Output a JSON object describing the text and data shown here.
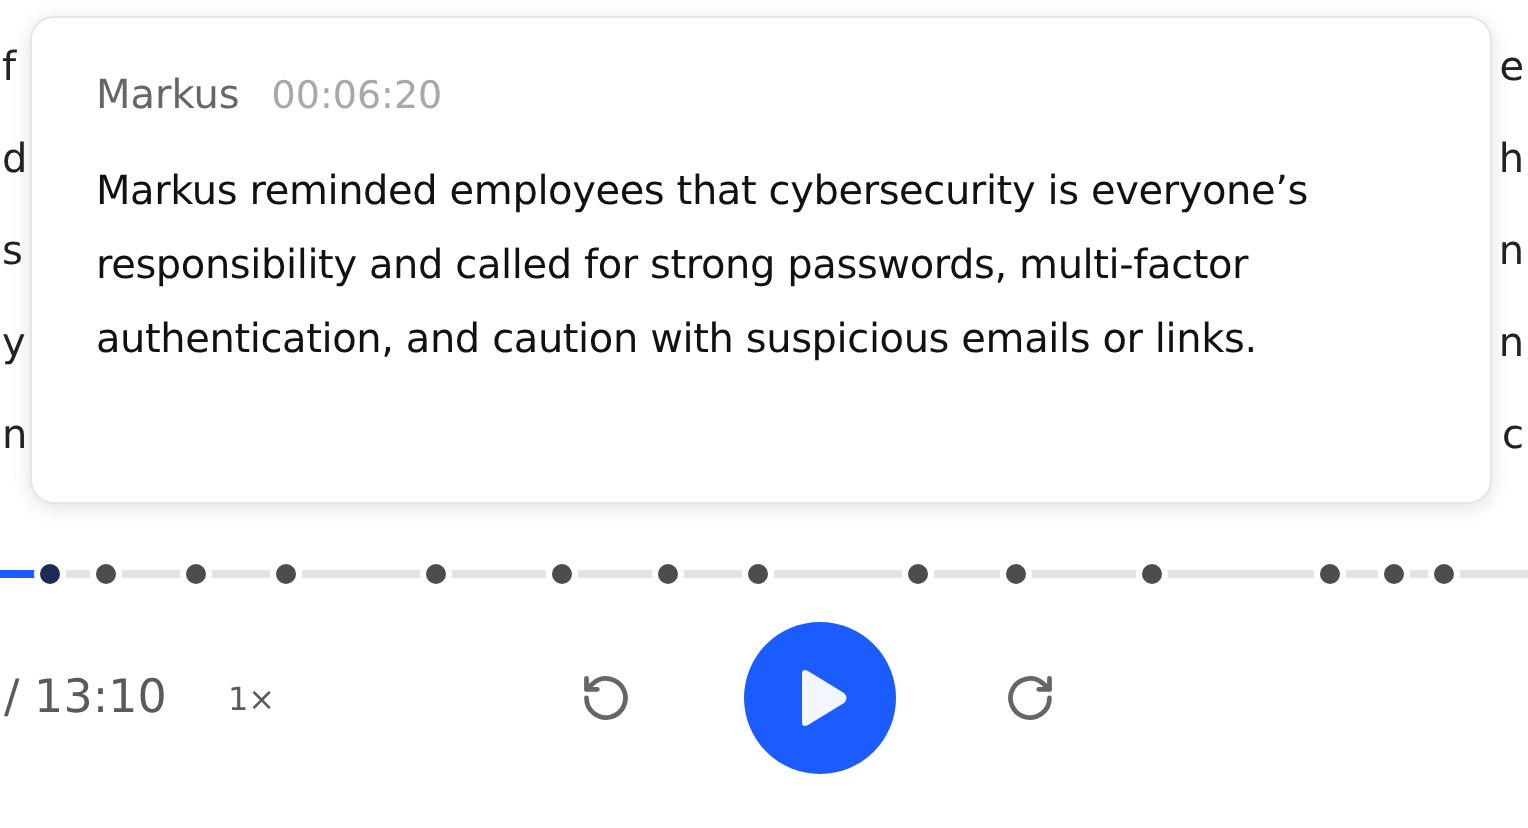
{
  "transcript": {
    "left_fragments": [
      "f",
      "d",
      "s",
      "y",
      "n"
    ],
    "right_fragments": [
      "e",
      "h",
      "n",
      "n",
      "c"
    ]
  },
  "tooltip": {
    "speaker": "Markus",
    "time": "00:06:20",
    "text": "Markus reminded employees that cybersecurity is everyone’s responsibility and called for strong passwords, multi-factor authentication, and caution with suspicious emails or links."
  },
  "timeline": {
    "level": 0.03,
    "markers": [
      {
        "level": 0.033,
        "selected": true
      },
      {
        "level": 0.07,
        "selected": false
      },
      {
        "level": 0.128,
        "selected": false
      },
      {
        "level": 0.187,
        "selected": false
      },
      {
        "level": 0.285,
        "selected": false
      },
      {
        "level": 0.368,
        "selected": false
      },
      {
        "level": 0.437,
        "selected": false
      },
      {
        "level": 0.496,
        "selected": false
      },
      {
        "level": 0.601,
        "selected": false
      },
      {
        "level": 0.665,
        "selected": false
      },
      {
        "level": 0.754,
        "selected": false
      },
      {
        "level": 0.87,
        "selected": false
      },
      {
        "level": 0.912,
        "selected": false
      },
      {
        "level": 0.945,
        "selected": false
      }
    ]
  },
  "controls": {
    "duration": "/ 13:10",
    "speed": "1×"
  }
}
